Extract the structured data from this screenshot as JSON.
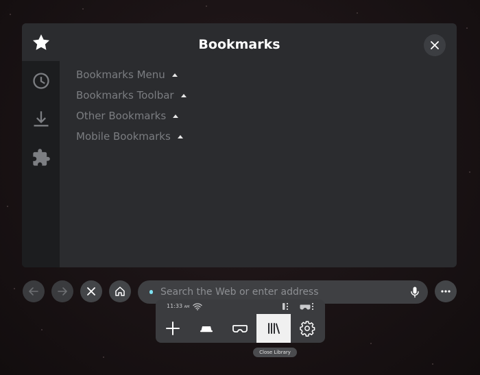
{
  "library": {
    "title": "Bookmarks",
    "sidebar": [
      "star-icon",
      "clock-icon",
      "download-icon",
      "puzzle-icon"
    ],
    "folders": [
      {
        "label": "Bookmarks Menu"
      },
      {
        "label": "Bookmarks Toolbar"
      },
      {
        "label": "Other Bookmarks"
      },
      {
        "label": "Mobile Bookmarks"
      }
    ]
  },
  "navbar": {
    "search_placeholder": "Search the Web or enter address"
  },
  "tray": {
    "time": "11:33",
    "ampm": "AM",
    "buttons": [
      "plus-icon",
      "private-mode-icon",
      "vr-headset-icon",
      "library-icon",
      "settings-icon"
    ],
    "active": "library-icon",
    "tooltip": "Close Library"
  },
  "colors": {
    "panel_bg": "#2b2c2f",
    "sidebar_bg": "#1c1d1f",
    "folder_text": "#7b7d81",
    "accent_dot": "#7ee0f0"
  }
}
